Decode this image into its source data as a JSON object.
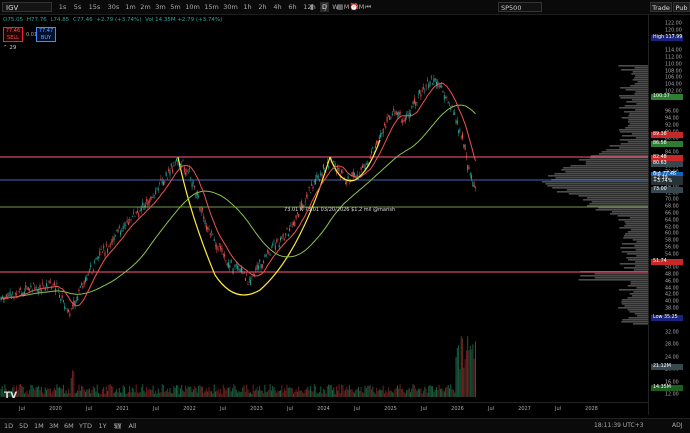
{
  "toolbar": {
    "symbol": "IGV",
    "timeframes": [
      "1s",
      "5s",
      "15s",
      "30s",
      "1m",
      "2m",
      "3m",
      "5m",
      "10m",
      "15m",
      "30m",
      "1h",
      "2h",
      "4h",
      "6h",
      "12h",
      "D",
      "W",
      "M",
      "3M"
    ],
    "active_timeframe": "D",
    "index_symbol": "SP500",
    "trade_label": "Trade",
    "publish_label": "Pub"
  },
  "legend": {
    "open": "O75.05",
    "high": "H77.76",
    "low": "L74.85",
    "close": "C77.46",
    "change": "+2.79 (+3.74%)",
    "volume": "Vol 14.35M +2.79 (+3.74%)",
    "sell_price": "77.46",
    "sell_label": "SELL",
    "spread": "0.01",
    "buy_price": "77.47",
    "buy_label": "BUY",
    "indicator_count": "29"
  },
  "annotation": "73.01 K 73.01 03/20/2026 $1.2 mil @marish",
  "price_axis": {
    "ticks": [
      "122.00",
      "120.00",
      "118.00",
      "114.00",
      "112.00",
      "110.00",
      "108.00",
      "106.00",
      "104.00",
      "102.00",
      "100.00",
      "96.00",
      "94.00",
      "92.00",
      "90.00",
      "88.00",
      "86.00",
      "84.00",
      "82.00",
      "80.00",
      "78.00",
      "76.00",
      "74.00",
      "72.00",
      "70.00",
      "68.00",
      "66.00",
      "64.00",
      "62.00",
      "60.00",
      "58.00",
      "56.00",
      "54.00",
      "50.00",
      "48.00",
      "46.00",
      "44.00",
      "42.00",
      "40.00",
      "38.00"
    ],
    "high_label": "High",
    "high_value": "117.99",
    "low_label": "Low",
    "low_value": "35.25",
    "badges": [
      {
        "text": "100.37",
        "color": "#2e7d32"
      },
      {
        "text": "89.38",
        "color": "#c62828"
      },
      {
        "text": "86.58",
        "color": "#2e7d32"
      },
      {
        "text": "82.48",
        "color": "#c62828"
      },
      {
        "text": "80.63",
        "color": "#37474f"
      },
      {
        "text": "Ask 77.47",
        "color": "#c62828"
      },
      {
        "text": "Bid 77.46",
        "color": "#1565c0"
      },
      {
        "text": "+2.79",
        "color": "#263238"
      },
      {
        "text": "+3.74%",
        "color": "#263238"
      },
      {
        "text": "73.00",
        "color": "#37474f"
      },
      {
        "text": "51.74",
        "color": "#c62828"
      }
    ]
  },
  "volume_axis": {
    "ticks": [
      "32.00",
      "28.00",
      "24.00",
      "20.00",
      "16.00",
      "12.00"
    ],
    "badge_a": "21.12M",
    "badge_b": "14.35M"
  },
  "time_axis": [
    "Jul",
    "2020",
    "Jul",
    "2021",
    "Jul",
    "2022",
    "Jul",
    "2023",
    "Jul",
    "2024",
    "Jul",
    "2025",
    "Jul",
    "2026",
    "Jul",
    "2027",
    "Jul",
    "2028"
  ],
  "range_buttons": [
    "1D",
    "5D",
    "1M",
    "3M",
    "6M",
    "YTD",
    "1Y",
    "5Y",
    "All"
  ],
  "clock": "18:11:39 UTC+3",
  "adj": "ADJ",
  "colors": {
    "up": "#26a69a",
    "down": "#ef5350",
    "ema_fast": "#ef5350",
    "sma_slow": "#8bc34a",
    "cup": "#ffeb3b",
    "resistance": "#ff5a7a",
    "support": "#5b8def"
  }
}
